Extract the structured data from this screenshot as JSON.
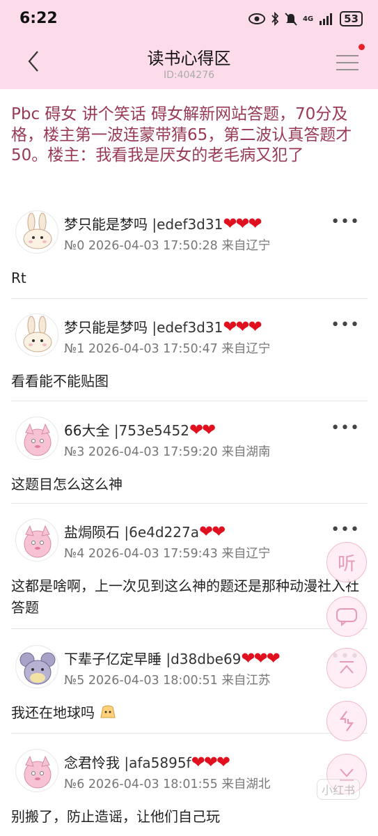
{
  "status_bar": {
    "time": "6:22",
    "battery": "53",
    "network": "4G"
  },
  "header": {
    "title": "读书心得区",
    "subtitle": "ID:404276"
  },
  "topic": {
    "title": "Pbc 碍女 讲个笑话 碍女解新网站答题，70分及格，楼主第一波连蒙带猜65，第二波认真答题才50。楼主：我看我是厌女的老毛病又犯了"
  },
  "posts": [
    {
      "name": "梦只能是梦吗",
      "uid": "|edef3d31",
      "hearts": "❤❤❤",
      "meta": "№0 2026-04-03 17:50:28 来自辽宁",
      "body": "Rt",
      "avatar": "rabbit-avatar"
    },
    {
      "name": "梦只能是梦吗",
      "uid": "|edef3d31",
      "hearts": "❤❤❤",
      "meta": "№1 2026-04-03 17:50:47 来自辽宁",
      "body": "看看能不能贴图",
      "avatar": "rabbit-avatar"
    },
    {
      "name": "66大全",
      "uid": "|753e5452",
      "hearts": "❤❤",
      "meta": "№3 2026-04-03 17:59:20 来自湖南",
      "body": "这题目怎么这么神",
      "avatar": "pink-monster-avatar"
    },
    {
      "name": "盐焗陨石",
      "uid": "|6e4d227a",
      "hearts": "❤❤",
      "meta": "№4 2026-04-03 17:59:43 来自辽宁",
      "body": "这都是啥啊，上一次见到这么神的题还是那种动漫社入社答题",
      "avatar": "pink-monster-avatar"
    },
    {
      "name": "下辈子亿定早睡",
      "uid": "|d38dbe69",
      "hearts": "❤❤❤",
      "meta": "№5 2026-04-03 18:00:51 来自江苏",
      "body": "我还在地球吗",
      "avatar": "gray-mouse-avatar"
    },
    {
      "name": "念君怜我",
      "uid": "|afa5895f",
      "hearts": "❤❤❤",
      "meta": "№6 2026-04-03 18:01:55 来自湖北",
      "body": "别搬了，防止造谣，让他们自己玩",
      "avatar": "pink-monster-avatar"
    }
  ],
  "more_label": "•••",
  "fabs": {
    "listen": "听",
    "comment_icon": "comment-icon",
    "top_icon": "scroll-top-icon",
    "refresh_icon": "refresh-icon",
    "bottom_icon": "scroll-bottom-icon"
  },
  "watermark": "小红书",
  "colors": {
    "header_bg": "#fcdceb",
    "title_color": "#993a55",
    "heart": "#e0101e",
    "fab_border": "#f2b8cd"
  }
}
